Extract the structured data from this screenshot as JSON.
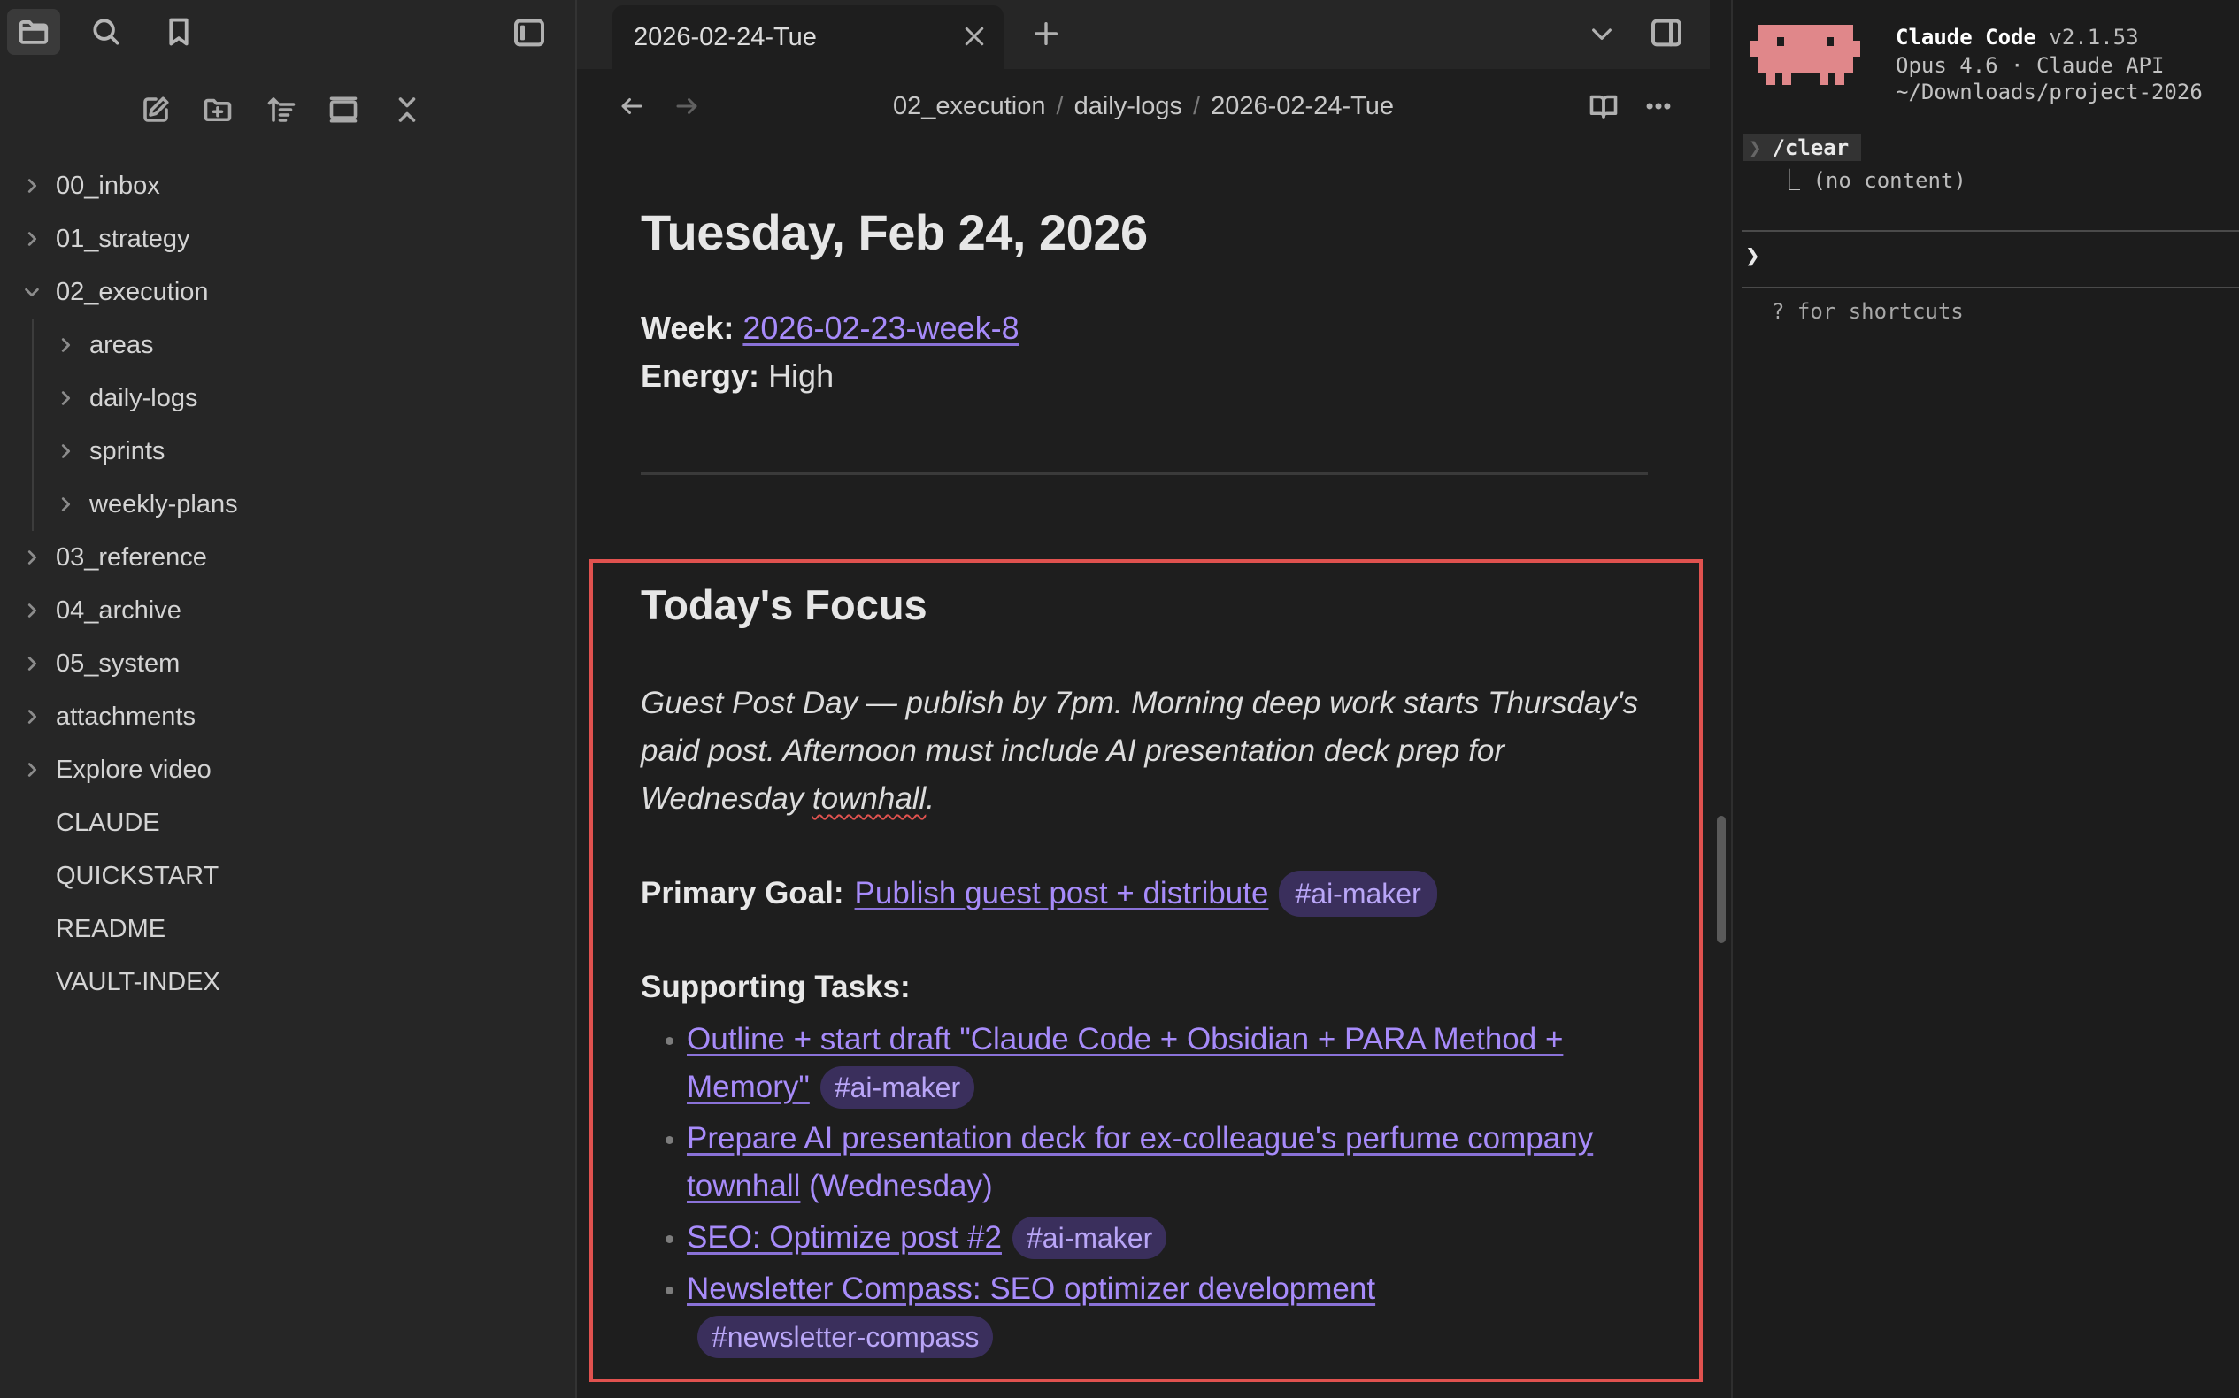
{
  "sidebar": {
    "top_icons": [
      "folder-icon",
      "search-icon",
      "bookmark-icon"
    ],
    "tree": [
      {
        "label": "00_inbox",
        "level": 0,
        "expandable": true,
        "expanded": false
      },
      {
        "label": "01_strategy",
        "level": 0,
        "expandable": true,
        "expanded": false
      },
      {
        "label": "02_execution",
        "level": 0,
        "expandable": true,
        "expanded": true
      },
      {
        "label": "areas",
        "level": 1,
        "expandable": true,
        "expanded": false
      },
      {
        "label": "daily-logs",
        "level": 1,
        "expandable": true,
        "expanded": false
      },
      {
        "label": "sprints",
        "level": 1,
        "expandable": true,
        "expanded": false
      },
      {
        "label": "weekly-plans",
        "level": 1,
        "expandable": true,
        "expanded": false
      },
      {
        "label": "03_reference",
        "level": 0,
        "expandable": true,
        "expanded": false
      },
      {
        "label": "04_archive",
        "level": 0,
        "expandable": true,
        "expanded": false
      },
      {
        "label": "05_system",
        "level": 0,
        "expandable": true,
        "expanded": false
      },
      {
        "label": "attachments",
        "level": 0,
        "expandable": true,
        "expanded": false
      },
      {
        "label": "Explore video",
        "level": 0,
        "expandable": true,
        "expanded": false
      },
      {
        "label": "CLAUDE",
        "level": 0,
        "expandable": false,
        "expanded": false
      },
      {
        "label": "QUICKSTART",
        "level": 0,
        "expandable": false,
        "expanded": false
      },
      {
        "label": "README",
        "level": 0,
        "expandable": false,
        "expanded": false
      },
      {
        "label": "VAULT-INDEX",
        "level": 0,
        "expandable": false,
        "expanded": false
      }
    ]
  },
  "tabs": {
    "active_title": "2026-02-24-Tue"
  },
  "breadcrumb": [
    "02_execution",
    "daily-logs",
    "2026-02-24-Tue"
  ],
  "note": {
    "title": "Tuesday, Feb 24, 2026",
    "week_label": "Week:",
    "week_link": "2026-02-23-week-8",
    "energy_label": "Energy:",
    "energy_value": "High",
    "focus_heading": "Today's Focus",
    "focus_text_1": "Guest Post Day — publish by 7pm. Morning deep work starts Thursday's paid post. Afternoon must include AI presentation deck prep for Wednesday ",
    "focus_text_squiggle": "townhall",
    "focus_text_2": ".",
    "primary_goal_label": "Primary Goal:",
    "primary_goal_link": "Publish guest post + distribute",
    "primary_goal_tag": "#ai-maker",
    "supporting_label": "Supporting Tasks:",
    "tasks": [
      {
        "link": "Outline + start draft \"Claude Code + Obsidian + PARA Method + Memory\"",
        "suffix": "",
        "tag": "#ai-maker"
      },
      {
        "link": "Prepare AI presentation deck for ex-colleague's perfume company townhall",
        "suffix": " (Wednesday)",
        "tag": ""
      },
      {
        "link": "SEO: Optimize post #2",
        "suffix": "",
        "tag": "#ai-maker"
      },
      {
        "link": "Newsletter Compass: SEO optimizer development",
        "suffix": "",
        "tag": "#newsletter-compass"
      }
    ]
  },
  "terminal": {
    "app_name": "Claude Code",
    "version": "v2.1.53",
    "model_line": "Opus 4.6 · Claude API",
    "path_line": "~/Downloads/project-2026",
    "command": "/clear",
    "command_output": "⎿ (no content)",
    "prompt_symbol": "❯",
    "shortcut_hint": "? for shortcuts"
  },
  "colors": {
    "accent_link": "#a78bfa",
    "highlight_box": "#e0524f",
    "tag_bg": "#3a2f5c",
    "mascot": "#e0878a"
  }
}
